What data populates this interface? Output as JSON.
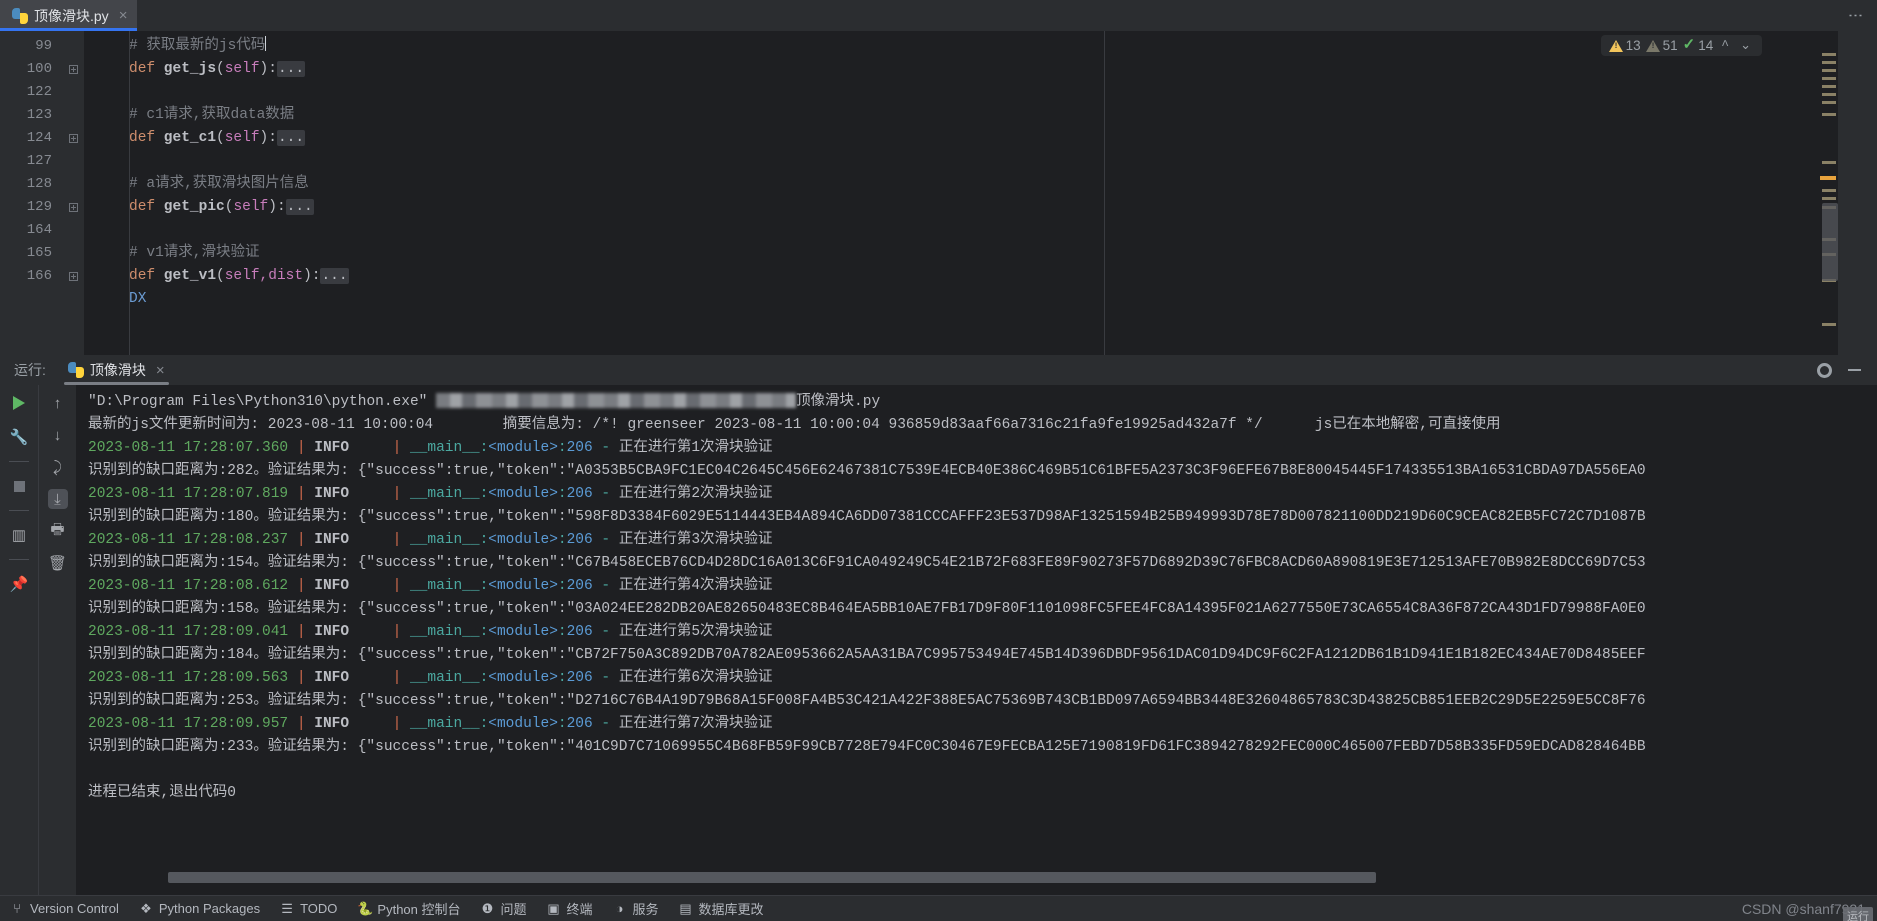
{
  "window": {
    "kebab_menu": "⋮"
  },
  "tabs": [
    {
      "label": "顶像滑块.py",
      "icon": "python-file-icon",
      "close": "×",
      "active": true
    }
  ],
  "editor": {
    "lines": [
      {
        "num": "99",
        "fold": false,
        "type": "comment",
        "text": "# 获取最新的js代码",
        "caret": true
      },
      {
        "num": "100",
        "fold": true,
        "type": "def",
        "kw": "def",
        "name": " get_js",
        "open": "(",
        "param": "self",
        "close": ")",
        "colon": ":",
        "ellipsis": "..."
      },
      {
        "num": "122",
        "fold": false,
        "type": "blank",
        "text": ""
      },
      {
        "num": "123",
        "fold": false,
        "type": "comment",
        "text": "# c1请求,获取data数据"
      },
      {
        "num": "124",
        "fold": true,
        "type": "def",
        "kw": "def",
        "name": " get_c1",
        "open": "(",
        "param": "self",
        "close": ")",
        "colon": ":",
        "ellipsis": "..."
      },
      {
        "num": "127",
        "fold": false,
        "type": "blank",
        "text": ""
      },
      {
        "num": "128",
        "fold": false,
        "type": "comment",
        "text": "# a请求,获取滑块图片信息"
      },
      {
        "num": "129",
        "fold": true,
        "type": "def",
        "kw": "def",
        "name": " get_pic",
        "open": "(",
        "param": "self",
        "close": ")",
        "colon": ":",
        "ellipsis": "..."
      },
      {
        "num": "164",
        "fold": false,
        "type": "blank",
        "text": ""
      },
      {
        "num": "165",
        "fold": false,
        "type": "comment",
        "text": "# v1请求,滑块验证"
      },
      {
        "num": "166",
        "fold": true,
        "type": "def",
        "kw": "def",
        "name": " get_v1",
        "open": "(",
        "param": "self,dist",
        "close": ")",
        "colon": ":",
        "ellipsis": "..."
      }
    ],
    "trailing_identifier": "DX",
    "inspections": {
      "warning_icon": "warning-triangle-icon",
      "warning_count": "13",
      "weak_warning_icon": "weak-warning-triangle-icon",
      "weak_warning_count": "51",
      "check_icon": "green-check-icon",
      "check_count": "14",
      "prev_icon": "^",
      "next_icon": "⌄"
    }
  },
  "run_panel": {
    "label": "运行:",
    "tab_label": "顶像滑块",
    "tab_close": "×",
    "settings_icon": "gear-icon",
    "minimize_icon": "minimize-icon",
    "toolbar_left": [
      {
        "name": "rerun-button",
        "icon": "play-icon"
      },
      {
        "name": "modify-run-configuration-button",
        "icon": "wrench-icon"
      },
      {
        "name": "stop-button",
        "icon": "stop-icon"
      },
      {
        "name": "layout-settings-button",
        "icon": "layout-icon"
      },
      {
        "name": "pin-tab-button",
        "icon": "pin-icon"
      }
    ],
    "toolbar_right": [
      {
        "name": "previous-occurrence-button",
        "icon": "arrow-up-icon"
      },
      {
        "name": "next-occurrence-button",
        "icon": "arrow-down-icon"
      },
      {
        "name": "soft-wrap-button",
        "icon": "soft-wrap-icon"
      },
      {
        "name": "scroll-to-end-button",
        "icon": "scroll-to-end-icon",
        "selected": true
      },
      {
        "name": "print-button",
        "icon": "printer-icon"
      },
      {
        "name": "clear-all-button",
        "icon": "trash-icon"
      }
    ],
    "console": {
      "command_prefix": "\"D:\\Program Files\\Python310\\python.exe\" ",
      "command_blurred_path": "",
      "command_suffix": "顶像滑块.py",
      "js_update_line": "最新的js文件更新时间为: 2023-08-11 10:00:04        摘要信息为: /*! greenseer 2023-08-11 10:00:04 936859d83aaf66a7316c21fa9fe19925ad432a7f */      js已在本地解密,可直接使用",
      "log_prefix_sep": "|",
      "log_level": "INFO",
      "log_source": "__main__:<module>:206",
      "log_dash": "-",
      "attempts": [
        {
          "timestamp": "2023-08-11 17:28:07.360",
          "message": "正在进行第1次滑块验证",
          "result_prefix": "识别到的缺口距离为:",
          "distance": "282",
          "result_mid": "。验证结果为: ",
          "token_json": "{\"success\":true,\"token\":\"A0353B5CBA9FC1EC04C2645C456E62467381C7539E4ECB40E386C469B51C61BFE5A2373C3F96EFE67B8E80045445F174335513BA16531CBDA97DA556EA0"
        },
        {
          "timestamp": "2023-08-11 17:28:07.819",
          "message": "正在进行第2次滑块验证",
          "result_prefix": "识别到的缺口距离为:",
          "distance": "180",
          "result_mid": "。验证结果为: ",
          "token_json": "{\"success\":true,\"token\":\"598F8D3384F6029E5114443EB4A894CA6DD07381CCCAFFF23E537D98AF13251594B25B949993D78E78D007821100DD219D60C9CEAC82EB5FC72C7D1087B"
        },
        {
          "timestamp": "2023-08-11 17:28:08.237",
          "message": "正在进行第3次滑块验证",
          "result_prefix": "识别到的缺口距离为:",
          "distance": "154",
          "result_mid": "。验证结果为: ",
          "token_json": "{\"success\":true,\"token\":\"C67B458ECEB76CD4D28DC16A013C6F91CA049249C54E21B72F683FE89F90273F57D6892D39C76FBC8ACD60A890819E3E712513AFE70B982E8DCC69D7C53"
        },
        {
          "timestamp": "2023-08-11 17:28:08.612",
          "message": "正在进行第4次滑块验证",
          "result_prefix": "识别到的缺口距离为:",
          "distance": "158",
          "result_mid": "。验证结果为: ",
          "token_json": "{\"success\":true,\"token\":\"03A024EE282DB20AE82650483EC8B464EA5BB10AE7FB17D9F80F1101098FC5FEE4FC8A14395F021A6277550E73CA6554C8A36F872CA43D1FD79988FA0E0"
        },
        {
          "timestamp": "2023-08-11 17:28:09.041",
          "message": "正在进行第5次滑块验证",
          "result_prefix": "识别到的缺口距离为:",
          "distance": "184",
          "result_mid": "。验证结果为: ",
          "token_json": "{\"success\":true,\"token\":\"CB72F750A3C892DB70A782AE0953662A5AA31BA7C995753494E745B14D396DBDF9561DAC01D94DC9F6C2FA1212DB61B1D941E1B182EC434AE70D8485EEF"
        },
        {
          "timestamp": "2023-08-11 17:28:09.563",
          "message": "正在进行第6次滑块验证",
          "result_prefix": "识别到的缺口距离为:",
          "distance": "253",
          "result_mid": "。验证结果为: ",
          "token_json": "{\"success\":true,\"token\":\"D2716C76B4A19D79B68A15F008FA4B53C421A422F388E5AC75369B743CB1BD097A6594BB3448E32604865783C3D43825CB851EEB2C29D5E2259E5CC8F76"
        },
        {
          "timestamp": "2023-08-11 17:28:09.957",
          "message": "正在进行第7次滑块验证",
          "result_prefix": "识别到的缺口距离为:",
          "distance": "233",
          "result_mid": "。验证结果为: ",
          "token_json": "{\"success\":true,\"token\":\"401C9D7C71069955C4B68FB59F99CB7728E794FC0C30467E9FECBA125E7190819FD61FC3894278292FEC000C465007FEBD7D58B335FD59EDCAD828464BB"
        }
      ],
      "exit_message": "进程已结束,退出代码0"
    }
  },
  "statusbar": {
    "items": [
      {
        "label": "Version Control",
        "icon": "branch-icon"
      },
      {
        "label": "Python Packages",
        "icon": "packages-icon"
      },
      {
        "label": "TODO",
        "icon": "todo-list-icon"
      },
      {
        "label": "Python 控制台",
        "icon": "python-console-icon"
      },
      {
        "label": "问题",
        "icon": "problems-icon"
      },
      {
        "label": "终端",
        "icon": "terminal-icon"
      },
      {
        "label": "服务",
        "icon": "services-icon"
      },
      {
        "label": "数据库更改",
        "icon": "database-changes-icon"
      }
    ],
    "watermark": "CSDN @shanf7921",
    "watermark_badge": "运行"
  }
}
